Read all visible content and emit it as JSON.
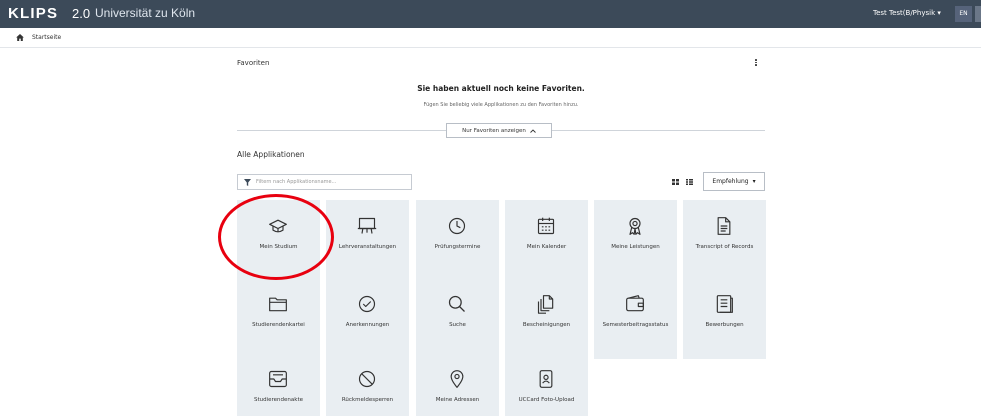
{
  "header": {
    "brand": "KLIPS",
    "version": "2.0",
    "university": "Universität zu Köln",
    "user": "Test Test(B/Physik",
    "language": "EN"
  },
  "breadcrumb": {
    "home": "Startseite"
  },
  "favorites": {
    "title": "Favoriten",
    "empty_title": "Sie haben aktuell noch keine Favoriten.",
    "empty_hint": "Fügen Sie beliebig viele Applikationen zu den Favoriten hinzu.",
    "toggle_label": "Nur Favoriten anzeigen"
  },
  "apps": {
    "title": "Alle Applikationen",
    "filter_placeholder": "Filtern nach Applikationsname...",
    "sort_label": "Empfehlung",
    "tiles": [
      {
        "label": "Mein Studium",
        "icon": "graduation-cap-icon"
      },
      {
        "label": "Lehrveranstaltungen",
        "icon": "presentation-board-icon"
      },
      {
        "label": "Prüfungstermine",
        "icon": "clock-icon"
      },
      {
        "label": "Mein Kalender",
        "icon": "calendar-icon"
      },
      {
        "label": "Meine Leistungen",
        "icon": "award-icon"
      },
      {
        "label": "Transcript of Records",
        "icon": "document-icon"
      },
      {
        "label": "Studierendenkartei",
        "icon": "folder-icon"
      },
      {
        "label": "Anerkennungen",
        "icon": "check-circle-icon"
      },
      {
        "label": "Suche",
        "icon": "search-icon"
      },
      {
        "label": "Bescheinigungen",
        "icon": "certificates-icon"
      },
      {
        "label": "Semesterbeitragsstatus",
        "icon": "wallet-icon"
      },
      {
        "label": "Bewerbungen",
        "icon": "application-list-icon"
      },
      {
        "label": "Studierendenakte",
        "icon": "student-file-icon"
      },
      {
        "label": "Rückmeldesperren",
        "icon": "block-icon"
      },
      {
        "label": "Meine Adressen",
        "icon": "location-pin-icon"
      },
      {
        "label": "UCCard Foto-Upload",
        "icon": "card-upload-icon"
      }
    ]
  },
  "colors": {
    "topbar": "#3c4a59",
    "tile_bg": "#e9eef2",
    "highlight": "#e8000f"
  }
}
